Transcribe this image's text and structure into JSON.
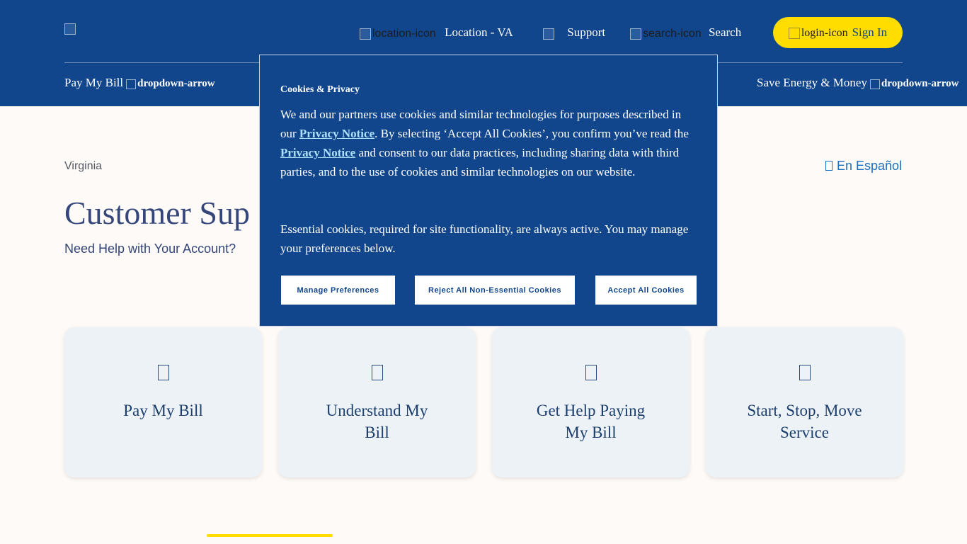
{
  "header": {
    "logo_alt": "",
    "location_icon_alt": "location-icon",
    "location_label": "Location - VA",
    "support_label": "Support",
    "search_icon_alt": "search-icon",
    "search_label": "Search",
    "login_icon_alt": "login-icon",
    "signin_label": "Sign In",
    "colors": {
      "bg": "#11468c",
      "signin_bg": "#ffdd00"
    }
  },
  "nav": {
    "items": [
      {
        "label": "Pay My Bill",
        "dropdown_alt": "dropdown-arrow"
      },
      {
        "label": "Save Energy & Money",
        "dropdown_alt": "dropdown-arrow"
      }
    ]
  },
  "main": {
    "breadcrumb": "Virginia",
    "language_icon": "globe-icon",
    "language_link": "En Español",
    "title": "Customer Sup",
    "subtitle": "Need Help with Your Account?",
    "cards": [
      {
        "label": "Pay My Bill",
        "icon": "bill-icon"
      },
      {
        "label": "Understand My Bill",
        "icon": "document-icon"
      },
      {
        "label": "Get Help Paying My Bill",
        "icon": "help-icon"
      },
      {
        "label": "Start, Stop, Move Service",
        "icon": "move-icon"
      }
    ]
  },
  "cookie": {
    "title": "Cookies & Privacy",
    "body_part1": "We and our partners use cookies and similar technologies for purposes described in our ",
    "privacy_link_1": "Privacy Notice",
    "body_part2": ". By selecting ‘Accept All Cookies’, you confirm you’ve read the ",
    "privacy_link_2": "Privacy Notice",
    "body_part3": " and consent to our data practices, including sharing data with third parties, and to the use of cookies and similar technologies on our website.",
    "body_essential": "Essential cookies, required for site functionality, are always active. You may manage your preferences below.",
    "manage_label": "Manage Preferences",
    "reject_label": "Reject All Non-Essential Cookies",
    "accept_label": "Accept All Cookies"
  }
}
